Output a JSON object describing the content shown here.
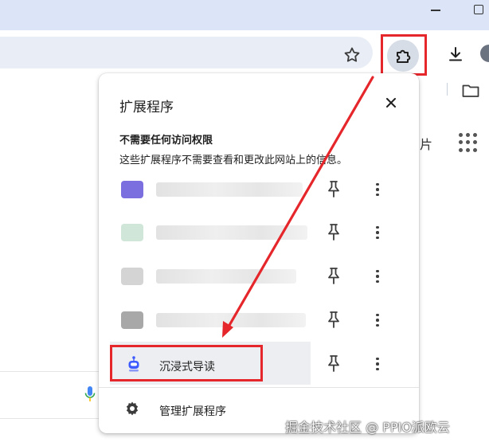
{
  "browser": {
    "toolbar": {
      "bookmark_icon": "star-icon",
      "extensions_icon": "puzzle-icon",
      "download_icon": "download-icon"
    },
    "side_text": "片"
  },
  "extensions_popup": {
    "title": "扩展程序",
    "section_title": "不需要任何访问权限",
    "section_desc": "这些扩展程序不需要查看和更改此网站上的信息。",
    "extensions": [
      {
        "name": "",
        "icon_color": "#7b6fe0"
      },
      {
        "name": "",
        "icon_color": "#cfe6d8"
      },
      {
        "name": "",
        "icon_color": "#d4d4d4"
      },
      {
        "name": "",
        "icon_color": "#a8a8a8"
      },
      {
        "name": "沉浸式导读",
        "icon_color": "#3d5afe"
      }
    ],
    "manage_label": "管理扩展程序"
  },
  "annotation": {
    "highlight_color": "#e5262b"
  },
  "watermark": "掘金技术社区 @ PPIO派欧云"
}
